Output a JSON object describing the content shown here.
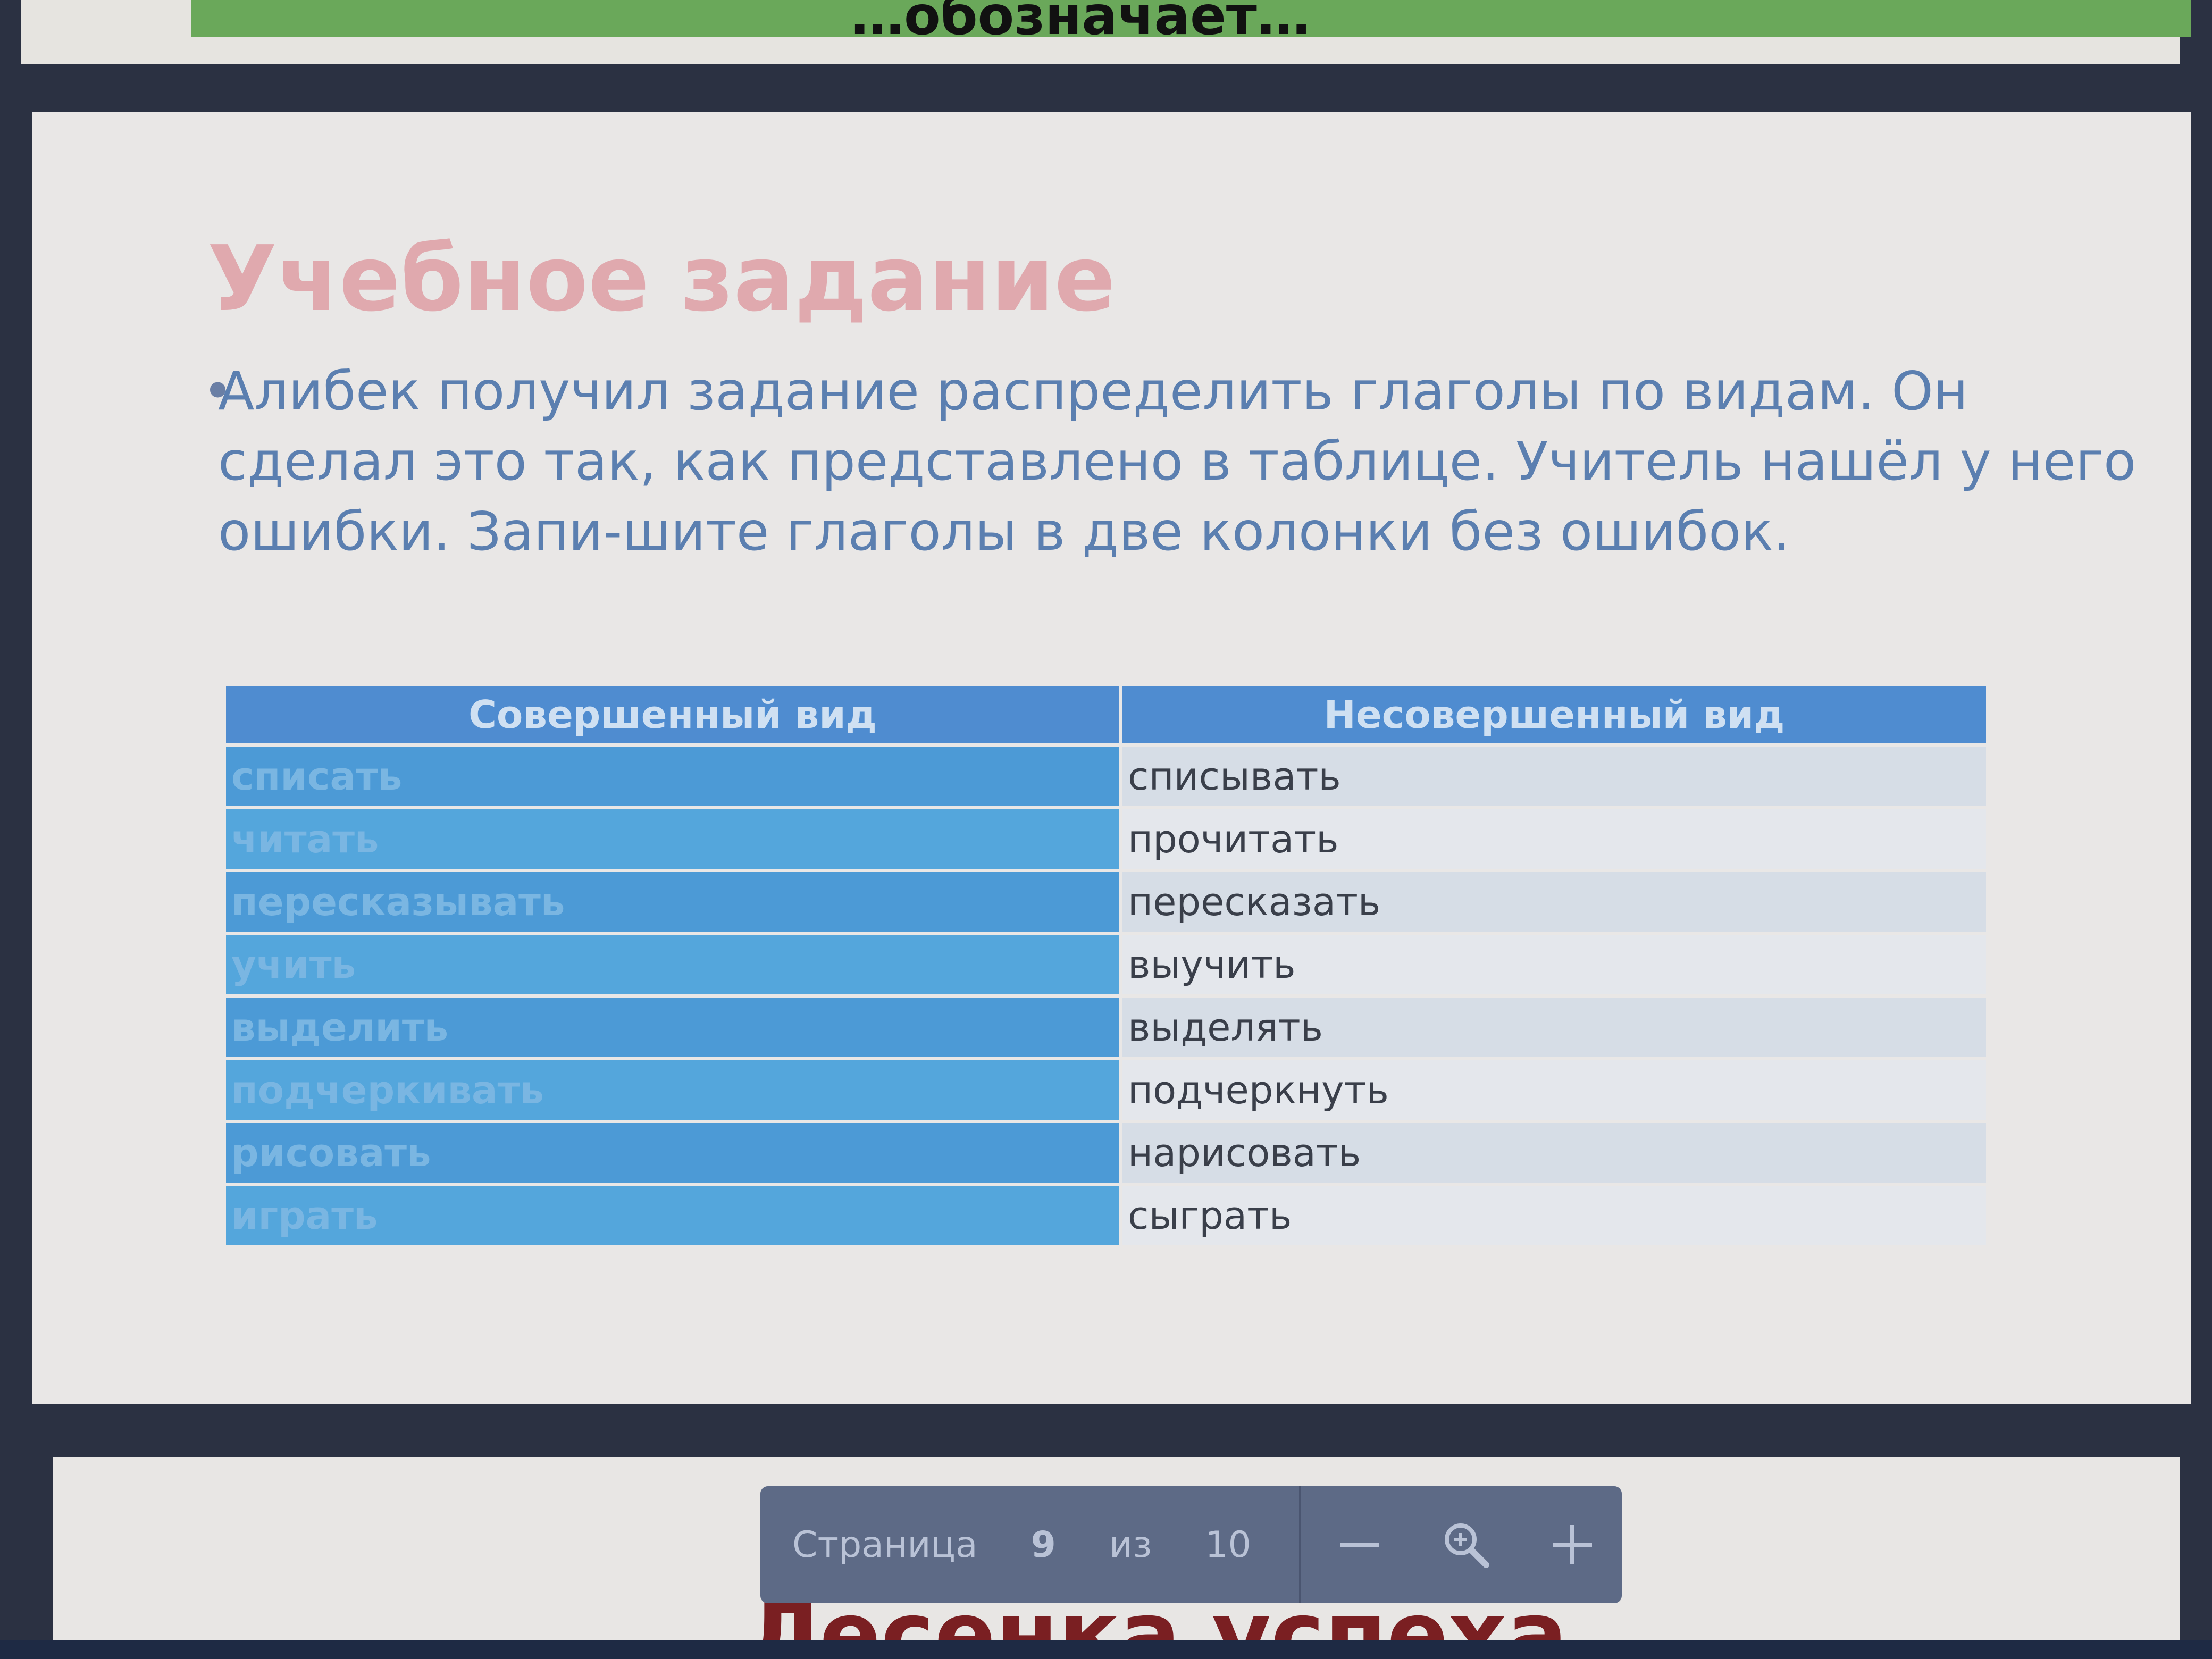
{
  "previous_slide": {
    "heading_fragment": "…обозначает…"
  },
  "slide": {
    "title": "Учебное задание",
    "bullet_text": "Алибек получил задание распределить глаголы по видам. Он сделал это так, как представлено в таблице. Учитель нашёл у него ошибки. Запи-шите глаголы в две колонки без ошибок.",
    "table": {
      "headers": [
        "Совершенный вид",
        "Несовершенный вид"
      ],
      "rows": [
        [
          "списать",
          "списывать"
        ],
        [
          "читать",
          "прочитать"
        ],
        [
          "пересказывать",
          "пересказать"
        ],
        [
          "учить",
          "выучить"
        ],
        [
          "выделить",
          "выделять"
        ],
        [
          "подчеркивать",
          "подчеркнуть"
        ],
        [
          "рисовать",
          "нарисовать"
        ],
        [
          "играть",
          "сыграть"
        ]
      ]
    }
  },
  "next_slide": {
    "title_fragment": "Лесенка успеха"
  },
  "navigation": {
    "page_label": "Страница",
    "current_page": "9",
    "of_label": "из",
    "total_pages": "10",
    "zoom_out_icon": "minus-icon",
    "zoom_icon": "magnifier-icon",
    "zoom_in_icon": "plus-icon"
  },
  "colors": {
    "title": "#e0a9ae",
    "bullet_text": "#5b7fb0",
    "table_header": "#4f8cd0",
    "left_column": "#4c9ad6",
    "right_column": "#d6dde6",
    "toolbar": "#5d6a86"
  }
}
